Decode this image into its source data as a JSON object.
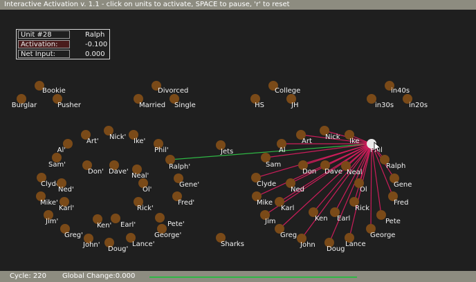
{
  "window": {
    "title": "Interactive Activation v. 1.1 - click on units to activate, SPACE to pause, 'r' to reset"
  },
  "info_panel": {
    "unit_key": "Unit #28",
    "unit_name": "Ralph",
    "activation_key": "Activation:",
    "activation_value": "-0.100",
    "net_input_key": "Net Input:",
    "net_input_value": "0.000"
  },
  "status": {
    "cycle": "Cycle: 220",
    "global_change": "Global Change:0.000",
    "progress_fraction": 1.0
  },
  "colors": {
    "unit_fill": "#7a4a18",
    "selected_unit_fill": "#eaeaea",
    "excitatory_link": "#2fb845",
    "inhibitory_link": "#cc1d5a",
    "background": "#1f1f1f",
    "bar": "#8d8c80"
  },
  "selected_hub": "hub-phil",
  "network": {
    "nodes": [
      {
        "id": "occ-bookie",
        "label": "Bookie"
      },
      {
        "id": "occ-burglar",
        "label": "Burglar"
      },
      {
        "id": "occ-pusher",
        "label": "Pusher"
      },
      {
        "id": "mar-divorced",
        "label": "Divorced"
      },
      {
        "id": "mar-married",
        "label": "Married"
      },
      {
        "id": "mar-single",
        "label": "Single"
      },
      {
        "id": "edu-college",
        "label": "College"
      },
      {
        "id": "edu-hs",
        "label": "HS"
      },
      {
        "id": "edu-jh",
        "label": "JH"
      },
      {
        "id": "age-in40s",
        "label": "in40s"
      },
      {
        "id": "age-in30s",
        "label": "in30s"
      },
      {
        "id": "age-in20s",
        "label": "in20s"
      },
      {
        "id": "gang-jets",
        "label": "Jets"
      },
      {
        "id": "gang-sharks",
        "label": "Sharks"
      },
      {
        "id": "inst-al",
        "label": "Al'"
      },
      {
        "id": "inst-art",
        "label": "Art'"
      },
      {
        "id": "inst-nick",
        "label": "Nick'"
      },
      {
        "id": "inst-ike",
        "label": "Ike'"
      },
      {
        "id": "inst-phil",
        "label": "Phil'"
      },
      {
        "id": "inst-sam",
        "label": "Sam'"
      },
      {
        "id": "inst-don",
        "label": "Don'"
      },
      {
        "id": "inst-dave",
        "label": "Dave'"
      },
      {
        "id": "inst-neal",
        "label": "Neal'"
      },
      {
        "id": "inst-ralph",
        "label": "Ralph'"
      },
      {
        "id": "inst-clyde",
        "label": "Clyde'"
      },
      {
        "id": "inst-ned",
        "label": "Ned'"
      },
      {
        "id": "inst-ol",
        "label": "Ol'"
      },
      {
        "id": "inst-gene",
        "label": "Gene'"
      },
      {
        "id": "inst-mike",
        "label": "Mike'"
      },
      {
        "id": "inst-karl",
        "label": "Karl'"
      },
      {
        "id": "inst-rick",
        "label": "Rick'"
      },
      {
        "id": "inst-fred",
        "label": "Fred'"
      },
      {
        "id": "inst-jim",
        "label": "Jim'"
      },
      {
        "id": "inst-ken",
        "label": "Ken'"
      },
      {
        "id": "inst-earl",
        "label": "Earl'"
      },
      {
        "id": "inst-pete",
        "label": "Pete'"
      },
      {
        "id": "inst-greg",
        "label": "Greg'"
      },
      {
        "id": "inst-george",
        "label": "George'"
      },
      {
        "id": "inst-john",
        "label": "John'"
      },
      {
        "id": "inst-doug",
        "label": "Doug'"
      },
      {
        "id": "inst-lance",
        "label": "Lance'"
      },
      {
        "id": "hub-al",
        "label": "Al"
      },
      {
        "id": "hub-art",
        "label": "Art"
      },
      {
        "id": "hub-nick",
        "label": "Nick"
      },
      {
        "id": "hub-ike",
        "label": "Ike"
      },
      {
        "id": "hub-phil",
        "label": "Phil"
      },
      {
        "id": "hub-sam",
        "label": "Sam"
      },
      {
        "id": "hub-don",
        "label": "Don"
      },
      {
        "id": "hub-dave",
        "label": "Dave"
      },
      {
        "id": "hub-neal",
        "label": "Neal"
      },
      {
        "id": "hub-ralph",
        "label": "Ralph"
      },
      {
        "id": "hub-clyde",
        "label": "Clyde"
      },
      {
        "id": "hub-ned",
        "label": "Ned"
      },
      {
        "id": "hub-ol",
        "label": "Ol"
      },
      {
        "id": "hub-gene",
        "label": "Gene"
      },
      {
        "id": "hub-mike",
        "label": "Mike"
      },
      {
        "id": "hub-karl",
        "label": "Karl"
      },
      {
        "id": "hub-rick",
        "label": "Rick"
      },
      {
        "id": "hub-fred",
        "label": "Fred"
      },
      {
        "id": "hub-jim",
        "label": "Jim"
      },
      {
        "id": "hub-ken",
        "label": "Ken"
      },
      {
        "id": "hub-earl",
        "label": "Earl"
      },
      {
        "id": "hub-pete",
        "label": "Pete"
      },
      {
        "id": "hub-greg",
        "label": "Greg"
      },
      {
        "id": "hub-george",
        "label": "George"
      },
      {
        "id": "hub-john",
        "label": "John"
      },
      {
        "id": "hub-doug",
        "label": "Doug"
      },
      {
        "id": "hub-lance",
        "label": "Lance"
      }
    ],
    "links": [
      {
        "from": "inst-ralph",
        "to": "hub-phil",
        "kind": "excitatory"
      },
      {
        "from": "hub-phil",
        "to": "hub-al",
        "kind": "inhibitory"
      },
      {
        "from": "hub-phil",
        "to": "hub-art",
        "kind": "inhibitory"
      },
      {
        "from": "hub-phil",
        "to": "hub-nick",
        "kind": "inhibitory"
      },
      {
        "from": "hub-phil",
        "to": "hub-ike",
        "kind": "inhibitory"
      },
      {
        "from": "hub-phil",
        "to": "hub-sam",
        "kind": "inhibitory"
      },
      {
        "from": "hub-phil",
        "to": "hub-don",
        "kind": "inhibitory"
      },
      {
        "from": "hub-phil",
        "to": "hub-dave",
        "kind": "inhibitory"
      },
      {
        "from": "hub-phil",
        "to": "hub-neal",
        "kind": "inhibitory"
      },
      {
        "from": "hub-phil",
        "to": "hub-ralph",
        "kind": "inhibitory"
      },
      {
        "from": "hub-phil",
        "to": "hub-clyde",
        "kind": "inhibitory"
      },
      {
        "from": "hub-phil",
        "to": "hub-ned",
        "kind": "inhibitory"
      },
      {
        "from": "hub-phil",
        "to": "hub-ol",
        "kind": "inhibitory"
      },
      {
        "from": "hub-phil",
        "to": "hub-gene",
        "kind": "inhibitory"
      },
      {
        "from": "hub-phil",
        "to": "hub-mike",
        "kind": "inhibitory"
      },
      {
        "from": "hub-phil",
        "to": "hub-karl",
        "kind": "inhibitory"
      },
      {
        "from": "hub-phil",
        "to": "hub-rick",
        "kind": "inhibitory"
      },
      {
        "from": "hub-phil",
        "to": "hub-fred",
        "kind": "inhibitory"
      },
      {
        "from": "hub-phil",
        "to": "hub-jim",
        "kind": "inhibitory"
      },
      {
        "from": "hub-phil",
        "to": "hub-ken",
        "kind": "inhibitory"
      },
      {
        "from": "hub-phil",
        "to": "hub-earl",
        "kind": "inhibitory"
      },
      {
        "from": "hub-phil",
        "to": "hub-pete",
        "kind": "inhibitory"
      },
      {
        "from": "hub-phil",
        "to": "hub-greg",
        "kind": "inhibitory"
      },
      {
        "from": "hub-phil",
        "to": "hub-george",
        "kind": "inhibitory"
      },
      {
        "from": "hub-phil",
        "to": "hub-john",
        "kind": "inhibitory"
      },
      {
        "from": "hub-phil",
        "to": "hub-doug",
        "kind": "inhibitory"
      },
      {
        "from": "hub-phil",
        "to": "hub-lance",
        "kind": "inhibitory"
      }
    ]
  }
}
